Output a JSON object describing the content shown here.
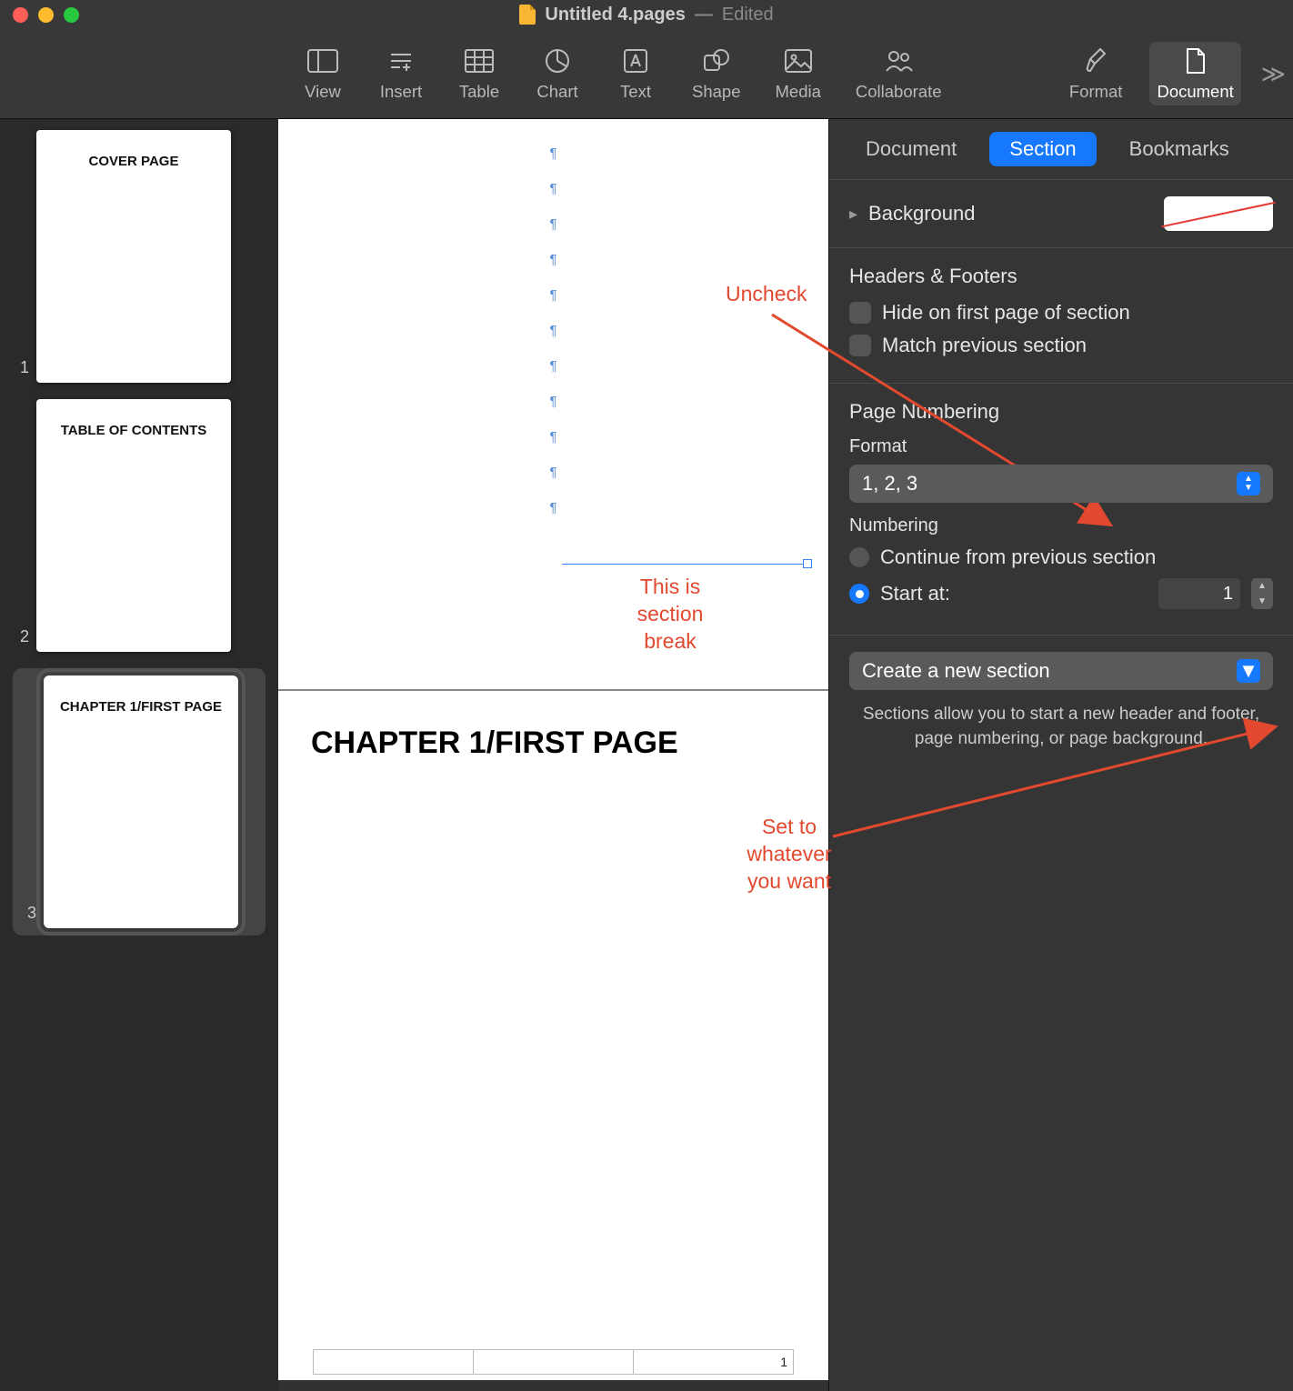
{
  "title_bar": {
    "filename": "Untitled 4.pages",
    "separator": "—",
    "edited_label": "Edited"
  },
  "toolbar": {
    "items": [
      {
        "label": "View"
      },
      {
        "label": "Insert"
      },
      {
        "label": "Table"
      },
      {
        "label": "Chart"
      },
      {
        "label": "Text"
      },
      {
        "label": "Shape"
      },
      {
        "label": "Media"
      },
      {
        "label": "Collaborate"
      }
    ],
    "right": [
      {
        "label": "Format"
      },
      {
        "label": "Document"
      }
    ]
  },
  "sidebar": {
    "thumbs": [
      {
        "num": "1",
        "label": "COVER PAGE"
      },
      {
        "num": "2",
        "label": "TABLE OF CONTENTS"
      },
      {
        "num": "3",
        "label": "CHAPTER 1/FIRST PAGE"
      }
    ]
  },
  "canvas": {
    "page2_heading": "CHAPTER 1/FIRST PAGE",
    "page2_footer_value": "1"
  },
  "annotations": {
    "uncheck": "Uncheck",
    "section_break": "This is section break",
    "set_to": "Set to whatever you want"
  },
  "inspector": {
    "tabs": {
      "document": "Document",
      "section": "Section",
      "bookmarks": "Bookmarks"
    },
    "background_label": "Background",
    "headers_footers_title": "Headers & Footers",
    "hide_first_label": "Hide on first page of section",
    "match_prev_label": "Match previous section",
    "page_numbering_title": "Page Numbering",
    "format_label": "Format",
    "format_value": "1, 2, 3",
    "numbering_label": "Numbering",
    "continue_label": "Continue from previous section",
    "start_at_label": "Start at:",
    "start_at_value": "1",
    "create_section_label": "Create a new section",
    "help_text": "Sections allow you to start a new header and footer, page numbering, or page background."
  }
}
